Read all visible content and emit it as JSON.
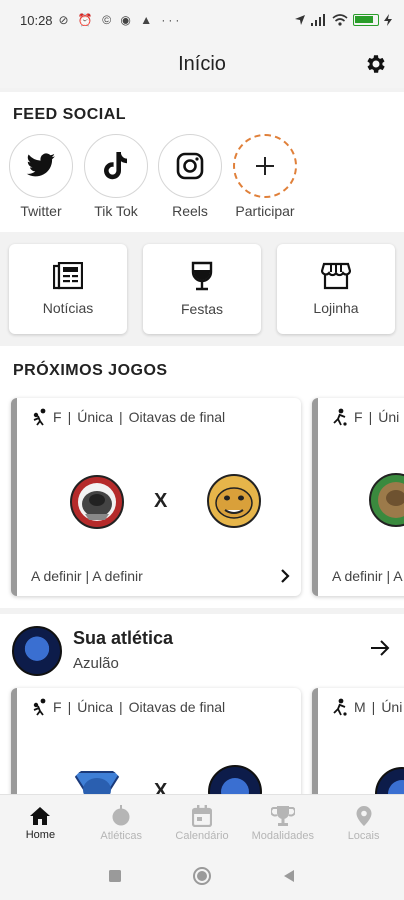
{
  "status": {
    "time": "10:28",
    "icons": "⊘ ⏰ © ◉ ▲ ···"
  },
  "header": {
    "title": "Início"
  },
  "feed": {
    "title": "FEED SOCIAL",
    "items": [
      {
        "label": "Twitter",
        "icon": "twitter-icon"
      },
      {
        "label": "Tik Tok",
        "icon": "tiktok-icon"
      },
      {
        "label": "Reels",
        "icon": "instagram-icon"
      },
      {
        "label": "Participar",
        "icon": "plus-icon"
      }
    ]
  },
  "quick": [
    {
      "label": "Notícias",
      "icon": "newspaper-icon"
    },
    {
      "label": "Festas",
      "icon": "wine-glass-icon"
    },
    {
      "label": "Lojinha",
      "icon": "store-icon"
    }
  ],
  "games": {
    "title": "PRÓXIMOS JOGOS",
    "cards": [
      {
        "gender": "F",
        "phase": "Única",
        "round": "Oitavas de final",
        "vs": "X",
        "footer": "A definir | A definir"
      },
      {
        "gender": "F",
        "phase": "Úni",
        "footer": "A definir | A"
      }
    ]
  },
  "sua": {
    "title": "Sua atlética",
    "subtitle": "Azulão",
    "cards": [
      {
        "gender": "F",
        "phase": "Única",
        "round": "Oitavas de final",
        "vs": "X"
      },
      {
        "gender": "M",
        "phase": "Úni"
      }
    ]
  },
  "nav": [
    {
      "label": "Home",
      "icon": "home-icon",
      "active": true
    },
    {
      "label": "Atléticas",
      "icon": "ball-icon",
      "active": false
    },
    {
      "label": "Calendário",
      "icon": "calendar-icon",
      "active": false
    },
    {
      "label": "Modalidades",
      "icon": "trophy-icon",
      "active": false
    },
    {
      "label": "Locais",
      "icon": "location-pin-icon",
      "active": false
    }
  ],
  "colors": {
    "accent": "#e0803a",
    "text": "#222222",
    "muted": "#b5b5b5",
    "card_border": "#9a9a9a"
  }
}
